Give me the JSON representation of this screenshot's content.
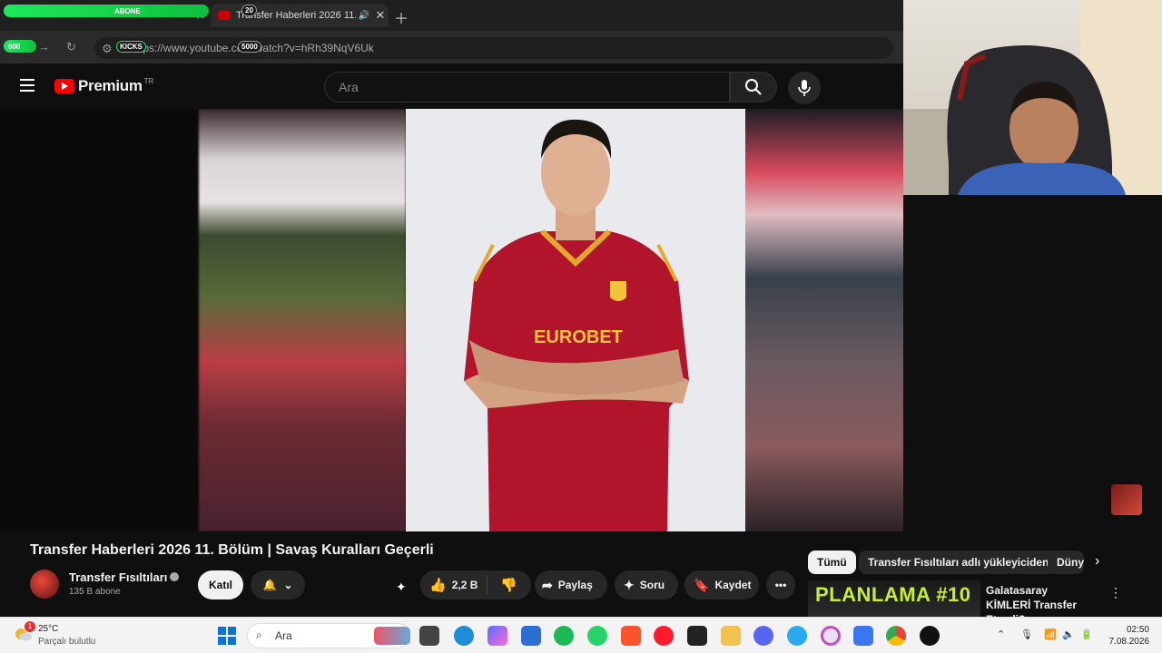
{
  "browser": {
    "tabs": [
      {
        "label": "",
        "active": false
      },
      {
        "label": "Transfer Haberleri 2026 11.",
        "active": true
      }
    ],
    "url": "https://www.youtube.com/watch?v=hRh39NqV6Uk"
  },
  "overlay": {
    "abone_label": "ABONE",
    "abone_count": "20",
    "kicks_label": "KICKS",
    "kicks_start": "600",
    "kicks_goal": "5000"
  },
  "youtube": {
    "logo_text": "Premium",
    "logo_region": "TR",
    "search_placeholder": "Ara"
  },
  "video": {
    "title": "Transfer Haberleri 2026 11. Bölüm | Savaş Kuralları Geçerli",
    "channel_name": "Transfer Fısıltıları",
    "subscribers": "135 B abone",
    "join_label": "Katıl",
    "likes": "2,2 B",
    "share_label": "Paylaş",
    "ask_label": "Soru",
    "save_label": "Kaydet",
    "jersey_sponsor": "EUROBET"
  },
  "sidebar": {
    "chips": [
      "Tümü",
      "Transfer Fısıltıları adlı yükleyiciden",
      "Düny"
    ],
    "recommended": {
      "thumb_text": "PLANLAMA #10",
      "title": "Galatasaray KİMLERİ Transfer Etmeli?"
    }
  },
  "taskbar": {
    "weather_badge": "1",
    "temperature": "25°C",
    "weather_desc": "Parçalı bulutlu",
    "search_label": "Ara",
    "time": "02:50",
    "date": "7.08.2026"
  }
}
